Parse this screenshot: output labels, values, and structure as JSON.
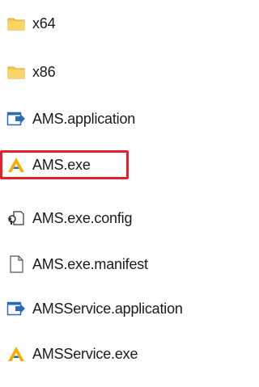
{
  "files": [
    {
      "name": "x64",
      "icon": "folder-icon"
    },
    {
      "name": "x86",
      "icon": "folder-icon"
    },
    {
      "name": "AMS.application",
      "icon": "application-manifest-icon"
    },
    {
      "name": "AMS.exe",
      "icon": "ams-executable-icon",
      "highlighted": true
    },
    {
      "name": "AMS.exe.config",
      "icon": "config-file-icon"
    },
    {
      "name": "AMS.exe.manifest",
      "icon": "generic-file-icon"
    },
    {
      "name": "AMSService.application",
      "icon": "application-manifest-icon"
    },
    {
      "name": "AMSService.exe",
      "icon": "ams-executable-icon"
    }
  ],
  "colors": {
    "highlight_border": "#e2202e",
    "folder": "#f5c84c",
    "ams_logo_yellow": "#f2b100",
    "ams_logo_blue": "#2a6bb8"
  }
}
